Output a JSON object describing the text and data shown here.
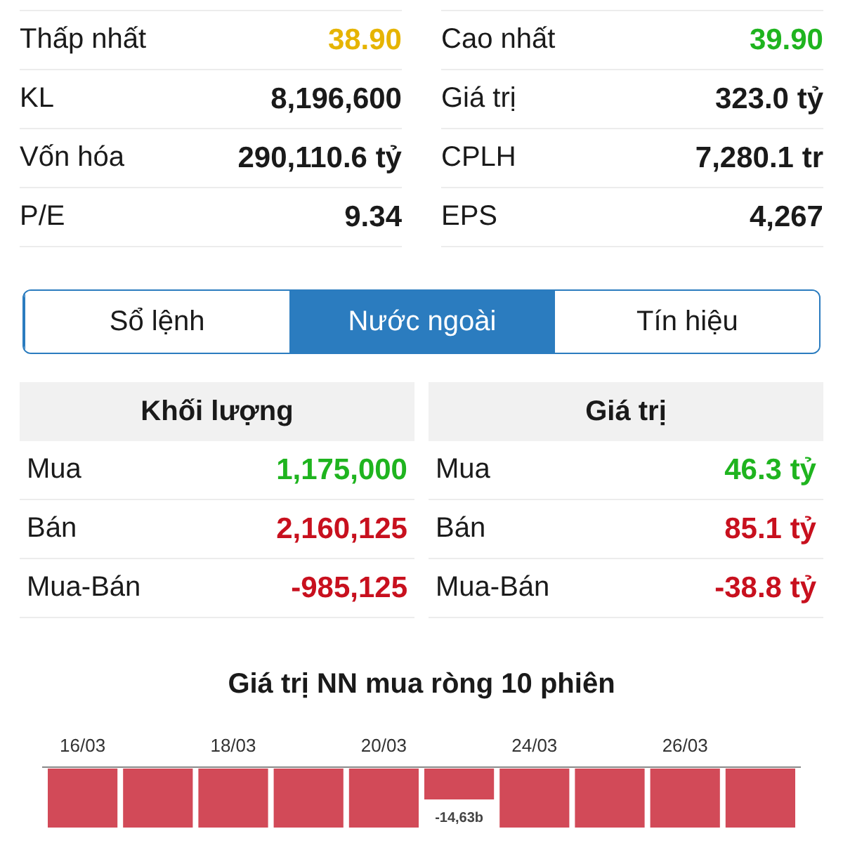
{
  "stats": [
    {
      "left": {
        "label": "Thấp nhất",
        "value": "38.90",
        "color": "#e6b400"
      },
      "right": {
        "label": "Cao nhất",
        "value": "39.90",
        "color": "#1fb41f"
      }
    },
    {
      "left": {
        "label": "KL",
        "value": "8,196,600"
      },
      "right": {
        "label": "Giá trị",
        "value": "323.0 tỷ"
      }
    },
    {
      "left": {
        "label": "Vốn hóa",
        "value": "290,110.6 tỷ"
      },
      "right": {
        "label": "CPLH",
        "value": "7,280.1 tr"
      }
    },
    {
      "left": {
        "label": "P/E",
        "value": "9.34"
      },
      "right": {
        "label": "EPS",
        "value": "4,267"
      }
    }
  ],
  "tabs": [
    {
      "label": "Sổ lệnh",
      "selected": false
    },
    {
      "label": "Nước ngoài",
      "selected": true
    },
    {
      "label": "Tín hiệu",
      "selected": false
    }
  ],
  "foreign": [
    {
      "heading": "Khối lượng",
      "rows": [
        {
          "label": "Mua",
          "value": "1,175,000",
          "color": "#1fb41f"
        },
        {
          "label": "Bán",
          "value": "2,160,125",
          "color": "#c8101e"
        },
        {
          "label": "Mua-Bán",
          "value": "-985,125",
          "color": "#c8101e"
        }
      ]
    },
    {
      "heading": "Giá trị",
      "rows": [
        {
          "label": "Mua",
          "value": "46.3 tỷ",
          "color": "#1fb41f"
        },
        {
          "label": "Bán",
          "value": "85.1 tỷ",
          "color": "#c8101e"
        },
        {
          "label": "Mua-Bán",
          "value": "-38.8 tỷ",
          "color": "#c8101e"
        }
      ]
    }
  ],
  "chart": {
    "title": "Giá trị NN mua ròng 10 phiên",
    "dates": [
      "16/03",
      "18/03",
      "20/03",
      "24/03",
      "26/03"
    ],
    "bars": [
      {
        "kind": "tall"
      },
      {
        "kind": "tall"
      },
      {
        "kind": "tall"
      },
      {
        "kind": "tall"
      },
      {
        "kind": "tall"
      },
      {
        "kind": "short",
        "label": "-14,63b"
      },
      {
        "kind": "tall"
      },
      {
        "kind": "tall"
      },
      {
        "kind": "tall"
      },
      {
        "kind": "tall"
      }
    ]
  }
}
